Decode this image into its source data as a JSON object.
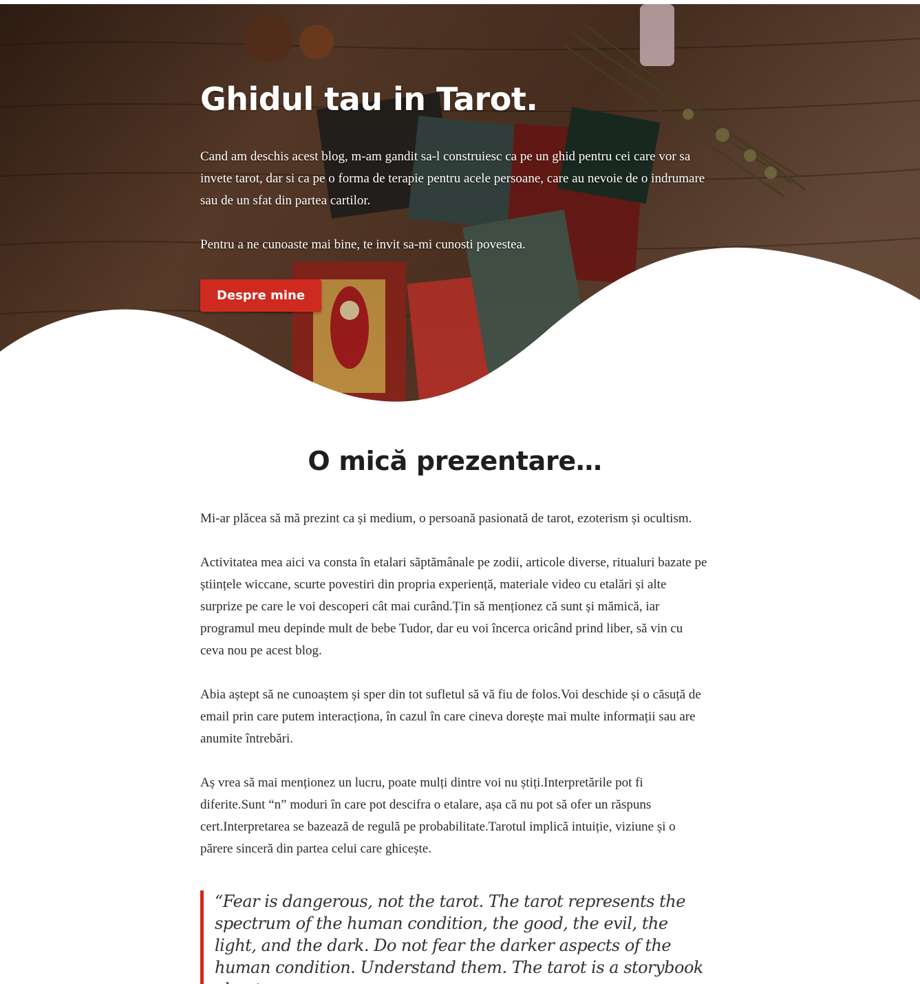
{
  "hero": {
    "title": "Ghidul tau in Tarot.",
    "paragraph1": "Cand am deschis acest blog, m-am gandit sa-l construiesc ca pe un ghid pentru cei care vor sa invete tarot, dar si ca pe o forma de terapie pentru acele persoane, care au nevoie de o indrumare sau de un sfat din partea cartilor.",
    "paragraph2": "Pentru a ne cunoaste mai bine, te invit sa-mi cunosti povestea.",
    "button_label": "Despre mine"
  },
  "intro": {
    "title": "O mică prezentare…",
    "paragraphs": [
      "Mi-ar plăcea să mă prezint ca și medium, o persoană pasionată de tarot, ezoterism și ocultism.",
      "Activitatea mea aici va consta în etalari săptămânale pe zodii, articole diverse, ritualuri bazate pe științele wiccane, scurte povestiri din propria experiență, materiale video cu etalări și alte surprize pe care le voi descoperi cât mai curând.Țin să menționez că sunt și mămică, iar programul meu depinde mult de bebe Tudor, dar eu voi încerca oricând prind liber, să vin cu ceva nou pe acest blog.",
      "Abia aștept să ne cunoaștem și sper din tot sufletul să vă fiu de folos.Voi deschide și o căsuță de email prin care putem interacționa, în cazul în care cineva dorește mai multe informații sau are anumite întrebări.",
      "Aș vrea să mai menționez un lucru, poate mulți dintre voi nu știți.Interpretările pot fi diferite.Sunt “n” moduri în care pot descifra o etalare, așa că nu pot să ofer un răspuns cert.Interpretarea se bazează de regulă pe probabilitate.Tarotul implică intuiție, viziune și o părere sinceră din partea celui care ghicește."
    ],
    "quote": "“Fear is dangerous, not the tarot. The tarot represents the spectrum of the human condition, the good, the evil, the light, and the dark. Do not fear the darker aspects of the human condition. Understand them. The tarot is a storybook about"
  },
  "colors": {
    "accent": "#cf2a1f",
    "hero_bg": "#4a2e1f"
  }
}
